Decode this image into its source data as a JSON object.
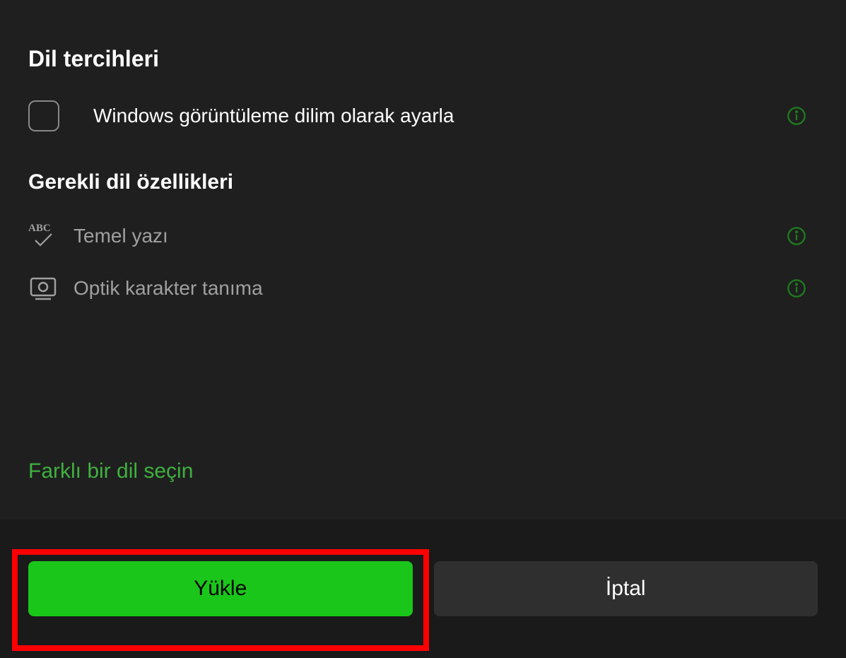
{
  "preferences": {
    "heading": "Dil tercihleri",
    "option_display_language": "Windows görüntüleme dilim olarak ayarla"
  },
  "features": {
    "heading": "Gerekli dil özellikleri",
    "items": [
      {
        "label": "Temel yazı",
        "icon": "abc-check-icon"
      },
      {
        "label": "Optik karakter tanıma",
        "icon": "ocr-icon"
      }
    ]
  },
  "link": "Farklı bir dil seçin",
  "footer": {
    "install_label": "Yükle",
    "cancel_label": "İptal"
  },
  "colors": {
    "accent": "#1ac61a",
    "info_icon": "#1d7a1d",
    "background": "#1f1f1f",
    "footer_bg": "#1a1a1a",
    "annotation": "#ff0000"
  }
}
